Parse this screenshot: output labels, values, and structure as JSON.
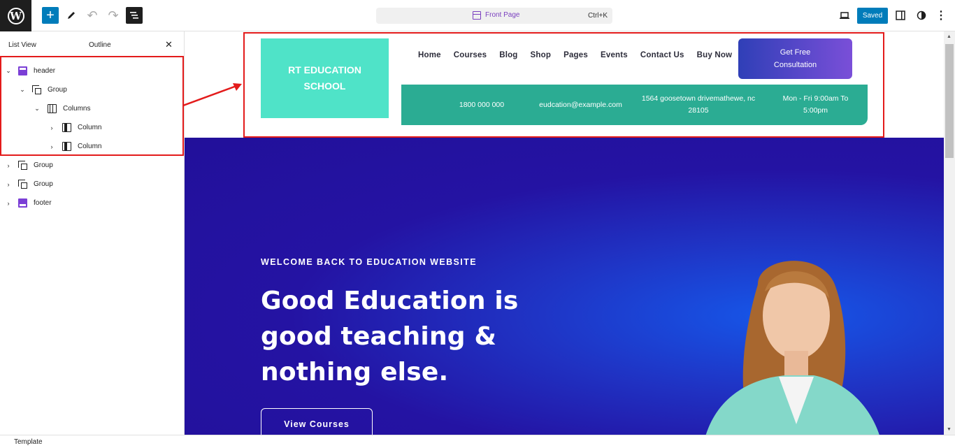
{
  "toolbar": {
    "wp_logo": "W",
    "add_icon": "+",
    "undo_icon": "↶",
    "redo_icon": "↷",
    "document_title": "Front Page",
    "shortcut": "Ctrl+K",
    "save_status": "Saved",
    "more_icon": "⋮"
  },
  "sidebar": {
    "tabs": [
      "List View",
      "Outline"
    ],
    "close_icon": "✕",
    "tree": [
      {
        "label": "header",
        "icon": "header-icon",
        "expanded": true
      },
      {
        "label": "Group",
        "icon": "group-icon",
        "expanded": true
      },
      {
        "label": "Columns",
        "icon": "columns-icon",
        "expanded": true
      },
      {
        "label": "Column",
        "icon": "column-icon",
        "expanded": false
      },
      {
        "label": "Column",
        "icon": "column-icon",
        "expanded": false
      },
      {
        "label": "Group",
        "icon": "group-icon",
        "expanded": false
      },
      {
        "label": "Group",
        "icon": "group-icon",
        "expanded": false
      },
      {
        "label": "footer",
        "icon": "footer-icon",
        "expanded": false
      }
    ],
    "chevron_expanded": "⌄",
    "chevron_collapsed": "›"
  },
  "site": {
    "logo": "RT EDUCATION SCHOOL",
    "nav": [
      "Home",
      "Courses",
      "Blog",
      "Shop",
      "Pages",
      "Events",
      "Contact Us",
      "Buy Now"
    ],
    "cta": "Get Free Consultation",
    "info": {
      "phone": "1800 000 000",
      "email": "eudcation@example.com",
      "address": "1564 goosetown drivemathewe, nc 28105",
      "hours": "Mon - Fri 9:00am To 5:00pm"
    }
  },
  "hero": {
    "kicker": "WELCOME BACK TO EDUCATION WEBSITE",
    "title": "Good Education is good teaching & nothing else.",
    "button": "View Courses"
  },
  "status": {
    "label": "Template"
  },
  "colors": {
    "wp_blue": "#007cba",
    "annotation_red": "#e31b1b",
    "logo_teal": "#4fe3c8",
    "info_green": "#2bac93",
    "hero_navy": "#22109a",
    "template_purple": "#7b3fd6"
  }
}
